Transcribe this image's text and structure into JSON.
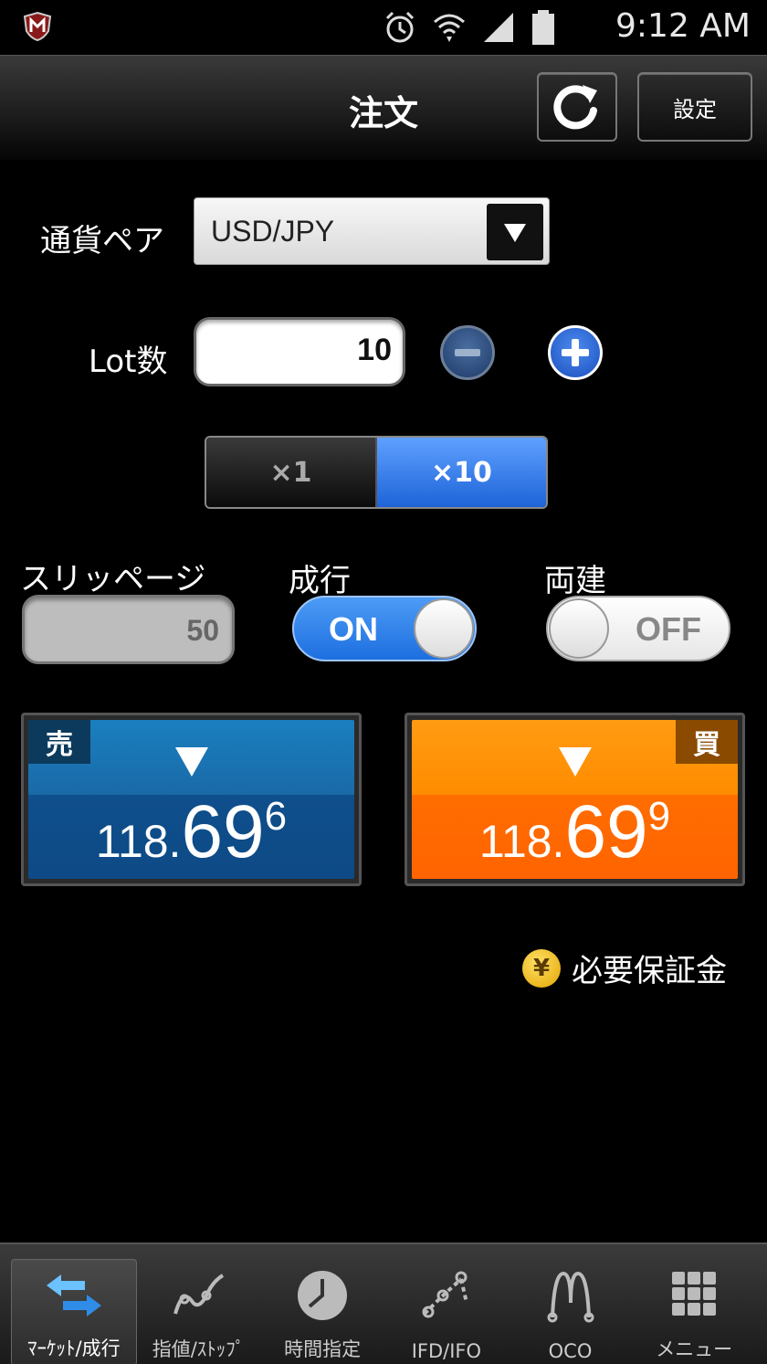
{
  "status_bar": {
    "time": "9:12 AM"
  },
  "header": {
    "title": "注文",
    "settings_label": "設定"
  },
  "form": {
    "currency_label": "通貨ペア",
    "currency_value": "USD/JPY",
    "lot_label": "Lot数",
    "lot_value": "10",
    "multiplier_options": [
      "×1",
      "×10"
    ],
    "multiplier_selected": "×10",
    "slippage_label": "スリッページ",
    "slippage_value": "50",
    "market_label": "成行",
    "market_toggle": "ON",
    "hedge_label": "両建",
    "hedge_toggle": "OFF"
  },
  "prices": {
    "sell": {
      "tag": "売",
      "price_main": "118.",
      "price_big": "69",
      "price_sup": "6",
      "color": "#1a6aa8"
    },
    "buy": {
      "tag": "買",
      "price_main": "118.",
      "price_big": "69",
      "price_sup": "9",
      "color": "#ff8c00"
    }
  },
  "margin_link": {
    "icon_text": "¥",
    "label": "必要保証金"
  },
  "bottom_nav": {
    "items": [
      {
        "label": "ﾏｰｹｯﾄ/成行",
        "icon": "market-arrows-icon",
        "active": true
      },
      {
        "label": "指値/ｽﾄｯﾌﾟ",
        "icon": "limit-chart-icon",
        "active": false
      },
      {
        "label": "時間指定",
        "icon": "clock-icon",
        "active": false
      },
      {
        "label": "IFD/IFO",
        "icon": "ifd-icon",
        "active": false
      },
      {
        "label": "OCO",
        "icon": "oco-icon",
        "active": false
      },
      {
        "label": "メニュー",
        "icon": "menu-grid-icon",
        "active": false
      }
    ]
  }
}
